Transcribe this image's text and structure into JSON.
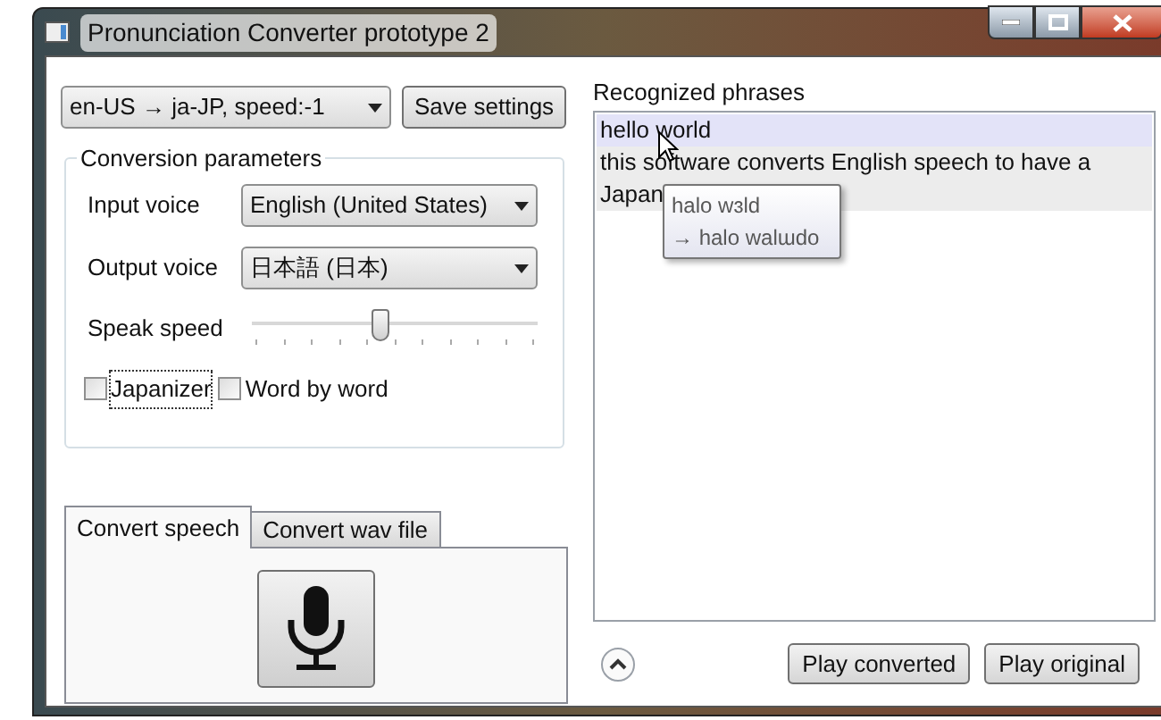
{
  "window": {
    "title": "Pronunciation Converter prototype 2"
  },
  "preset": {
    "value": "en-US → ja-JP, speed:-1"
  },
  "save_button": "Save settings",
  "conversion_parameters": {
    "title": "Conversion parameters",
    "input_voice": {
      "label": "Input voice",
      "value": "English (United States)"
    },
    "output_voice": {
      "label": "Output voice",
      "value": "日本語 (日本)"
    },
    "speak_speed": {
      "label": "Speak speed",
      "level": 0.45
    },
    "checkboxes": [
      {
        "label": "Japanizer",
        "checked": false,
        "focused": true
      },
      {
        "label": "Word by word",
        "checked": false,
        "focused": false
      }
    ]
  },
  "tabs": [
    {
      "label": "Convert speech",
      "selected": true
    },
    {
      "label": "Convert wav file",
      "selected": false
    }
  ],
  "recognized": {
    "title": "Recognized phrases",
    "phrases": [
      {
        "lines": [
          "hello world"
        ],
        "selected": true
      },
      {
        "lines": [
          "this software converts English speech to have a",
          "Japan"
        ],
        "selected": false
      }
    ],
    "tooltip": [
      "halo wɜld",
      "→ halo walɯdo"
    ]
  },
  "buttons": [
    "Play converted",
    "Play original"
  ]
}
